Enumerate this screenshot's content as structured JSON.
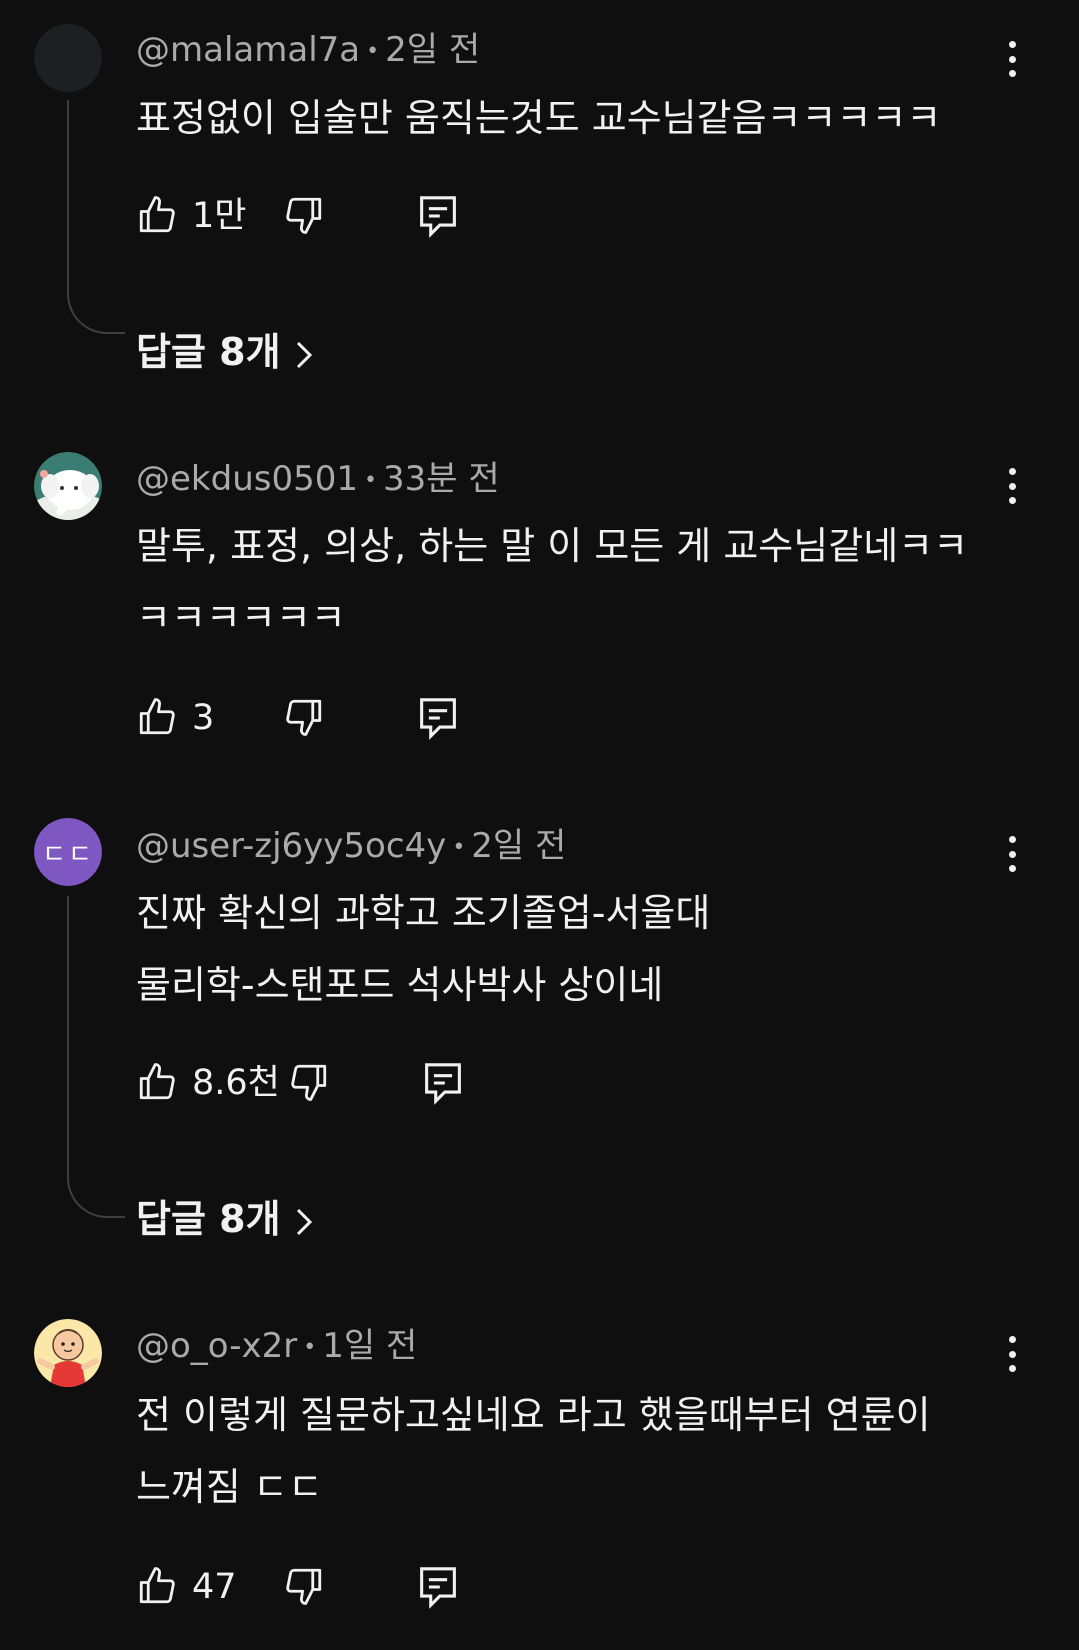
{
  "colors": {
    "background": "#0f0f0f",
    "text": "#f1f1f1",
    "meta_text": "#aaaaaa",
    "avatar_purple": "#7e57c2"
  },
  "comments": [
    {
      "handle": "@malamal7a",
      "time": "2일 전",
      "lines": [
        "표정없이 입술만 움직는것도 교수님같음ㅋㅋㅋㅋㅋ"
      ],
      "likes": "1만",
      "replies_label": "답글 8개",
      "avatar_icon": "dark-avatar"
    },
    {
      "handle": "@ekdus0501",
      "time": "33분 전",
      "lines": [
        "말투, 표정, 의상, 하는 말 이 모든 게 교수님같네ㅋㅋ",
        "ㅋㅋㅋㅋㅋㅋ"
      ],
      "likes": "3",
      "avatar_icon": "elephant-avatar"
    },
    {
      "handle": "@user-zj6yy5oc4y",
      "time": "2일 전",
      "lines": [
        "진짜 확신의 과학고 조기졸업-서울대",
        "물리학-스탠포드 석사박사 상이네"
      ],
      "likes": "8.6천",
      "replies_label": "답글 8개",
      "avatar_text": "ㄷㄷ",
      "avatar_icon": "letter-avatar"
    },
    {
      "handle": "@o_o-x2r",
      "time": "1일 전",
      "lines": [
        "전 이렇게 질문하고싶네요 라고 했을때부터 연륜이",
        "느껴짐 ㄷㄷ"
      ],
      "likes": "47",
      "avatar_icon": "cartoon-boy-avatar"
    }
  ],
  "separator": "•"
}
